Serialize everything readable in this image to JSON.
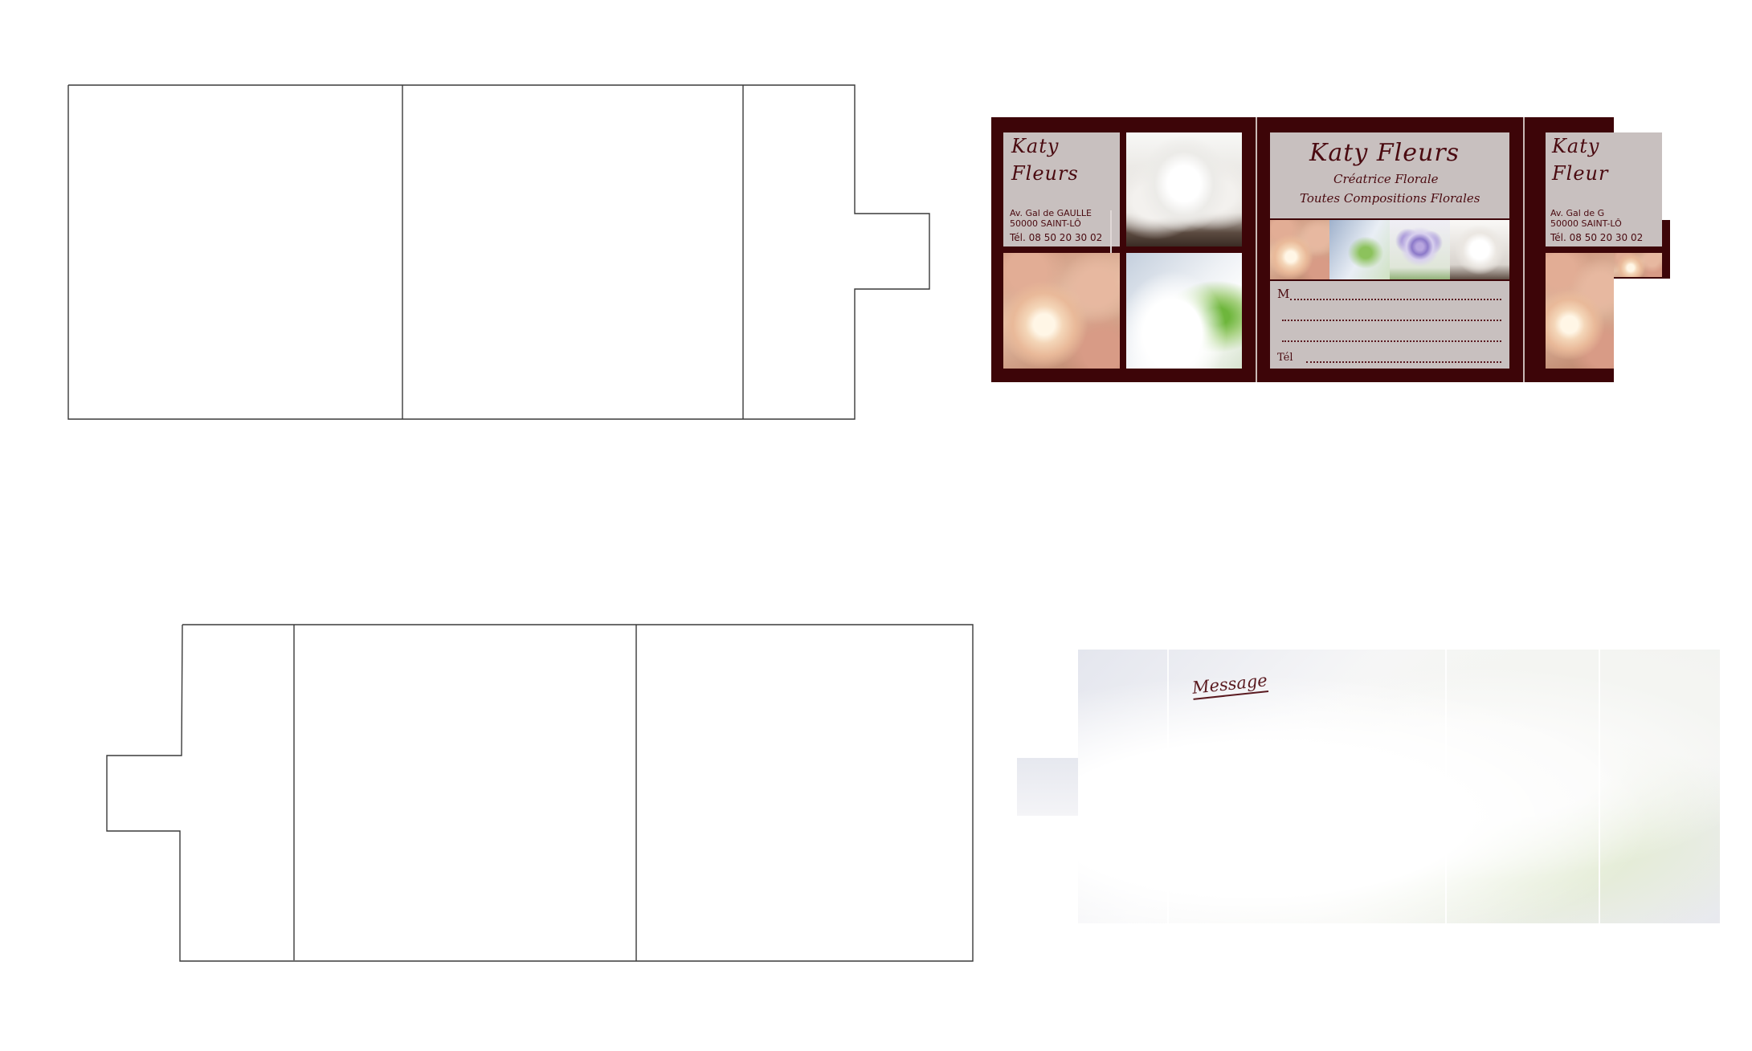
{
  "card": {
    "brand_line1": "Katy",
    "brand_line2": "Fleurs",
    "address_line1": "Av. Gal de GAULLE",
    "address_line2": "50000 SAINT-LÔ",
    "phone": "Tél. 08 50 20 30 02",
    "center_title": "Katy Fleurs",
    "center_subtitle": "Créatrice Florale",
    "center_tagline": "Toutes Compositions Florales",
    "form_name_label": "M",
    "form_phone_label": "Tél",
    "flap_line1": "Katy",
    "flap_line2": "Fleur",
    "flap_address_line1": "Av. Gal de G",
    "flap_address_line2": "50000 SAINT-LÔ",
    "flap_phone": "Tél. 08 50 20 30 02",
    "color_background": "#3d0508",
    "color_panel": "#c8c0bf",
    "color_text": "#4a0a10"
  },
  "insert": {
    "label": "Message"
  }
}
